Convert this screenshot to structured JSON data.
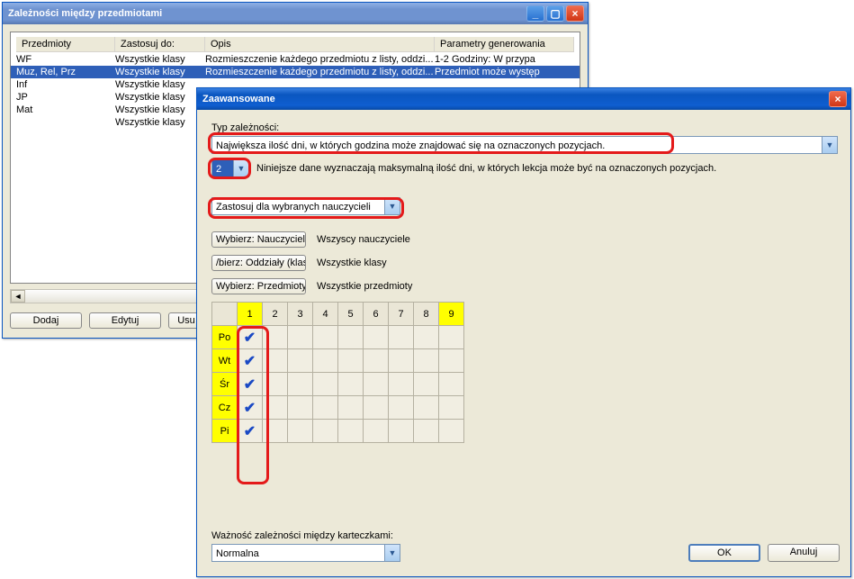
{
  "back": {
    "title": "Zależności między przedmiotami",
    "columns": [
      "Przedmioty",
      "Zastosuj do:",
      "Opis",
      "Parametry generowania"
    ],
    "rows": [
      {
        "c": [
          "WF",
          "Wszystkie klasy",
          "Rozmieszczenie każdego przedmiotu z listy, oddzi...",
          "1-2 Godziny: W przypa"
        ]
      },
      {
        "c": [
          "Muz, Rel, Prz",
          "Wszystkie klasy",
          "Rozmieszczenie każdego przedmiotu z listy, oddzi...",
          "Przedmiot może występ"
        ],
        "sel": true
      },
      {
        "c": [
          "Inf",
          "Wszystkie klasy",
          "",
          ""
        ]
      },
      {
        "c": [
          "JP",
          "Wszystkie klasy",
          "",
          ""
        ]
      },
      {
        "c": [
          "Mat",
          "Wszystkie klasy",
          "",
          ""
        ]
      },
      {
        "c": [
          "",
          "Wszystkie klasy",
          "",
          ""
        ]
      }
    ],
    "buttons": {
      "add": "Dodaj",
      "edit": "Edytuj",
      "del": "Usu"
    }
  },
  "front": {
    "title": "Zaawansowane",
    "type_label": "Typ zależności:",
    "type_value": "Największa ilość dni, w których godzina może znajdować się na oznaczonych pozycjach.",
    "count_value": "2",
    "count_note": "Niniejsze dane wyznaczają maksymalną ilość dni, w których lekcja może być na oznaczonych pozycjach.",
    "apply_value": "Zastosuj dla wybranych nauczycieli",
    "picks": [
      {
        "btn": "Wybierz: Nauczyciele /",
        "val": "Wszyscy nauczyciele"
      },
      {
        "btn": "/bierz: Oddziały (klasy",
        "val": "Wszystkie klasy"
      },
      {
        "btn": "Wybierz: Przedmioty /",
        "val": "Wszystkie przedmioty"
      }
    ],
    "cols": [
      "1",
      "2",
      "3",
      "4",
      "5",
      "6",
      "7",
      "8",
      "9"
    ],
    "days": [
      "Po",
      "Wt",
      "Śr",
      "Cz",
      "Pi"
    ],
    "col1_checked": true,
    "importance_label": "Ważność zależności między karteczkami:",
    "importance_value": "Normalna",
    "ok": "OK",
    "cancel": "Anuluj"
  }
}
